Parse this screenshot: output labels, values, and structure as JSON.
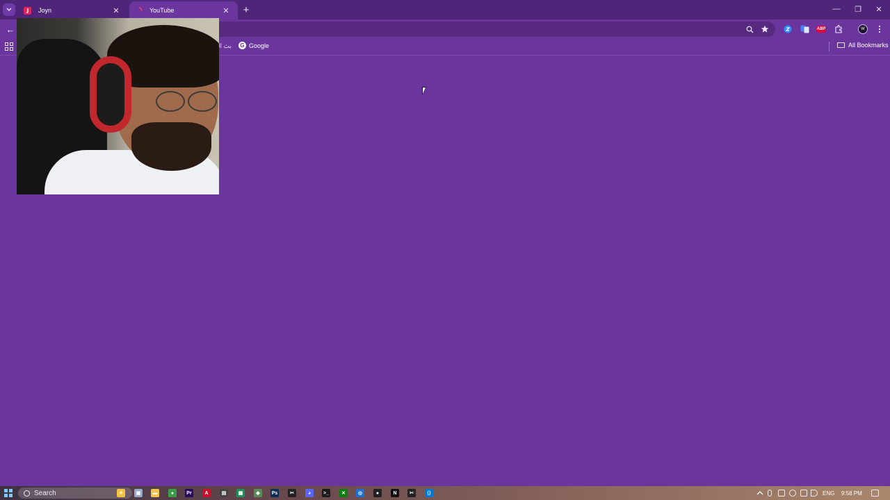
{
  "browser": {
    "tabs": [
      {
        "title": "Joyn",
        "favicon_color": "#e0245e",
        "active": false
      },
      {
        "title": "YouTube",
        "favicon_color": "#ff3b6b",
        "active": true
      }
    ],
    "new_tab_symbol": "+",
    "close_symbol": "✕",
    "window_controls": {
      "minimize": "—",
      "restore": "❐",
      "close": "✕"
    },
    "back_symbol": "←",
    "toolbar_icons": [
      "zoom-icon",
      "bookmark-star-icon",
      "extension-blue-icon",
      "translate-icon",
      "adblock-plus-icon",
      "extensions-puzzle-icon",
      "profile-avatar-icon",
      "menu-kebab-icon"
    ],
    "adblock_label": "ABP",
    "profile_initial": "W"
  },
  "bookmarks": {
    "arabic_item": "بث ال",
    "google_label": "Google",
    "all_bookmarks": "All Bookmarks"
  },
  "page": {
    "background": "#6a359d"
  },
  "taskbar": {
    "search_placeholder": "Search",
    "apps": [
      {
        "name": "copilot",
        "label": "✦",
        "color": "#f5c242"
      },
      {
        "name": "task-view",
        "label": "▣",
        "color": "#9aa7c7"
      },
      {
        "name": "file-explorer",
        "label": "▬",
        "color": "#f2c14e"
      },
      {
        "name": "chrome",
        "label": "●",
        "color": "#3b9c4a"
      },
      {
        "name": "premiere",
        "label": "Pr",
        "color": "#2a0a5c"
      },
      {
        "name": "acrobat",
        "label": "A",
        "color": "#c8102e"
      },
      {
        "name": "app-generic",
        "label": "▤",
        "color": "#444"
      },
      {
        "name": "sheets",
        "label": "▦",
        "color": "#1e8e5a"
      },
      {
        "name": "app-green",
        "label": "◆",
        "color": "#5b8a5b"
      },
      {
        "name": "photoshop",
        "label": "Ps",
        "color": "#0b2d55"
      },
      {
        "name": "capcut",
        "label": "✂",
        "color": "#222"
      },
      {
        "name": "discord",
        "label": "◕",
        "color": "#5865f2"
      },
      {
        "name": "terminal",
        "label": ">_",
        "color": "#1b1b1b"
      },
      {
        "name": "xbox",
        "label": "✕",
        "color": "#107c10"
      },
      {
        "name": "app-blue",
        "label": "◎",
        "color": "#1d6fd1"
      },
      {
        "name": "app-dark",
        "label": "●",
        "color": "#222"
      },
      {
        "name": "notion",
        "label": "N",
        "color": "#111"
      },
      {
        "name": "capcut-2",
        "label": "✂",
        "color": "#222"
      },
      {
        "name": "vscode",
        "label": "⟨⟩",
        "color": "#0078d4"
      }
    ],
    "language": "ENG",
    "time": "9:58 PM"
  }
}
